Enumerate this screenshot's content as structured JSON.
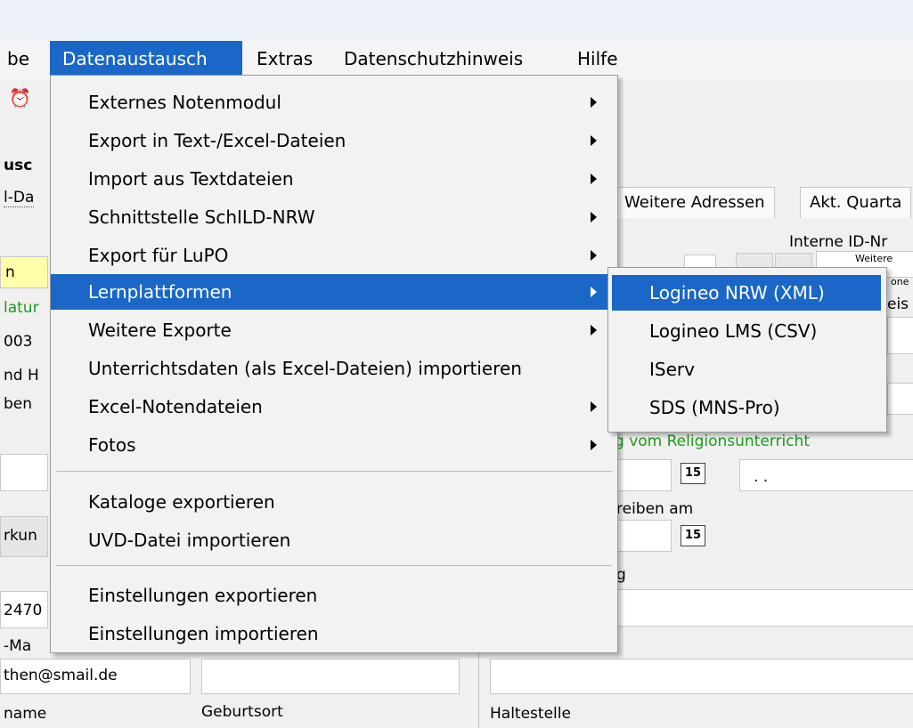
{
  "menubar": {
    "items": [
      {
        "label": "be"
      },
      {
        "label": "Datenaustausch"
      },
      {
        "label": "Extras"
      },
      {
        "label": "Datenschutzhinweis"
      },
      {
        "label": "Hilfe"
      }
    ]
  },
  "dropdown": {
    "items": [
      {
        "label": "Externes Notenmodul"
      },
      {
        "label": "Export in Text-/Excel-Dateien"
      },
      {
        "label": "Import aus Textdateien"
      },
      {
        "label": "Schnittstelle SchILD-NRW"
      },
      {
        "label": "Export für LuPO"
      },
      {
        "label": "Lernplattformen"
      },
      {
        "label": "Weitere Exporte"
      },
      {
        "label": "Unterrichtsdaten (als Excel-Dateien) importieren"
      },
      {
        "label": "Excel-Notendateien"
      },
      {
        "label": "Fotos"
      },
      {
        "label": "Kataloge exportieren"
      },
      {
        "label": "UVD-Datei importieren"
      },
      {
        "label": "Einstellungen exportieren"
      },
      {
        "label": "Einstellungen importieren"
      }
    ]
  },
  "submenu": {
    "items": [
      {
        "label": "Logineo NRW (XML)"
      },
      {
        "label": "Logineo LMS (CSV)"
      },
      {
        "label": "IServ"
      },
      {
        "label": "SDS (MNS-Pro)"
      }
    ]
  },
  "background": {
    "tab_weitere_adressen": "Weitere Adressen",
    "tab_akt_quartal": "Akt. Quarta",
    "interne_id": "Interne ID-Nr",
    "weitere_small": "Weitere",
    "one_small": "one",
    "eis": "eis",
    "left_usc": "usc",
    "left_ida": "l-Da",
    "left_n": "n",
    "left_datu": "latur",
    "left_003": "003",
    "left_ndh": "nd H",
    "left_ben": "ben",
    "left_rkun": "rkun",
    "left_2470": "2470",
    "left_ma": "-Ma",
    "email_value": "then@smail.de",
    "name_label": "name",
    "geburtsort_label": "Geburtsort",
    "haltestelle_label": "Haltestelle",
    "religion_text": "g vom Religionsunterricht",
    "date_placeholder": ". .",
    "reiben_am": "reiben am",
    "g_label": "g",
    "cal_label": "15"
  }
}
